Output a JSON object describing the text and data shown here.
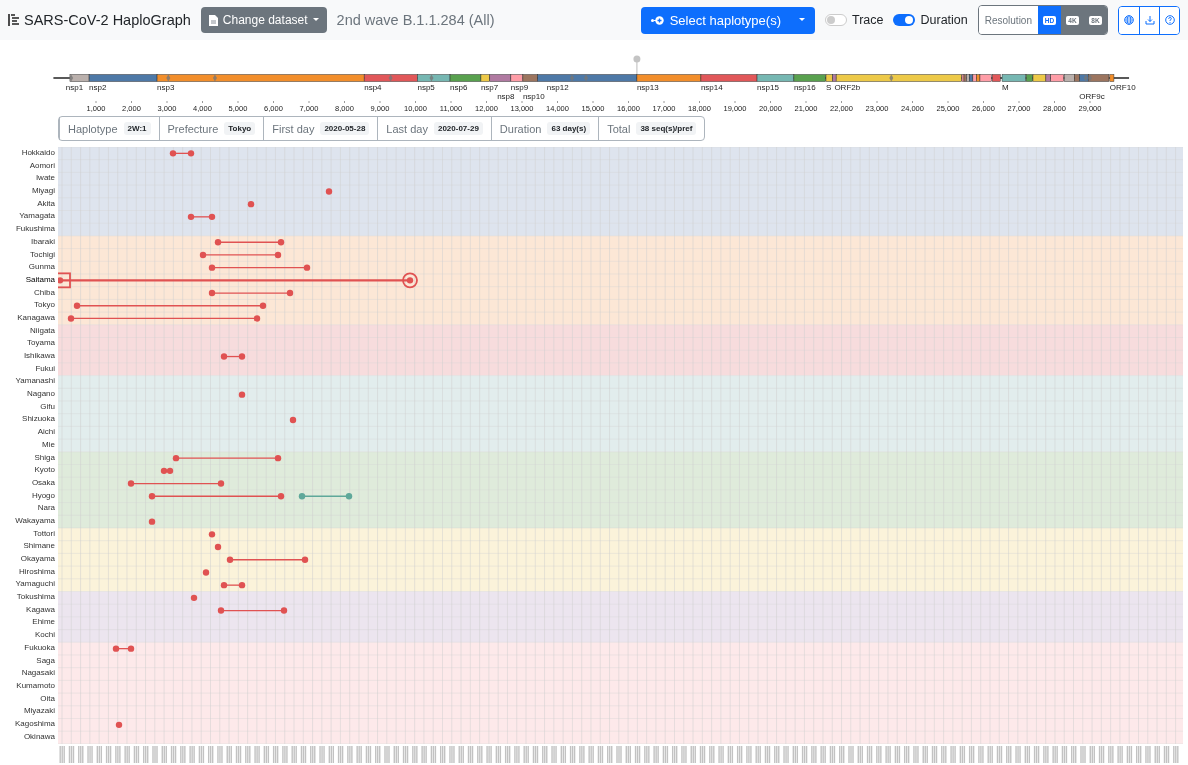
{
  "header": {
    "title": "SARS-CoV-2 HaploGraph",
    "dataset_button": "Change dataset",
    "dataset_name": "2nd wave B.1.1.284 (All)",
    "haplotype_button": "Select haplotype(s)",
    "toggles": [
      {
        "label": "Trace",
        "on": false
      },
      {
        "label": "Duration",
        "on": true
      }
    ],
    "resolution": {
      "label": "Resolution",
      "options": [
        {
          "label": "HD",
          "selected": true
        },
        {
          "label": "4K",
          "selected": false
        },
        {
          "label": "8K",
          "selected": false
        }
      ]
    }
  },
  "genome": {
    "labels": [
      "nsp1",
      "nsp2",
      "nsp3",
      "nsp4",
      "nsp5",
      "nsp6",
      "nsp7",
      "nsp8",
      "nsp9",
      "nsp10",
      "nsp12",
      "nsp13",
      "nsp14",
      "nsp15",
      "nsp16",
      "S",
      "ORF2b",
      "M",
      "ORF9c",
      "ORF10"
    ],
    "ticks": [
      "1,000",
      "2,000",
      "3,000",
      "4,000",
      "5,000",
      "6,000",
      "7,000",
      "8,000",
      "9,000",
      "10,000",
      "11,000",
      "12,000",
      "13,000",
      "14,000",
      "15,000",
      "16,000",
      "17,000",
      "18,000",
      "19,000",
      "20,000",
      "21,000",
      "22,000",
      "23,000",
      "24,000",
      "25,000",
      "26,000",
      "27,000",
      "28,000",
      "29,000"
    ]
  },
  "info": [
    {
      "label": "Haplotype",
      "value": "2W:1"
    },
    {
      "label": "Prefecture",
      "value": "Tokyo"
    },
    {
      "label": "First day",
      "value": "2020-05-28"
    },
    {
      "label": "Last day",
      "value": "2020-07-29"
    },
    {
      "label": "Duration",
      "value": "63 day(s)"
    },
    {
      "label": "Total",
      "value": "38 seq(s)/pref"
    }
  ],
  "regions": [
    {
      "color": "#dee4ee",
      "prefectures": [
        {
          "name": "Hokkaido",
          "selected": false
        },
        {
          "name": "Aomori",
          "selected": false
        },
        {
          "name": "Iwate",
          "selected": false
        },
        {
          "name": "Miyagi",
          "selected": false
        },
        {
          "name": "Akita",
          "selected": false
        },
        {
          "name": "Yamagata",
          "selected": false
        },
        {
          "name": "Fukushima",
          "selected": false
        }
      ]
    },
    {
      "color": "#fce7d6",
      "prefectures": [
        {
          "name": "Ibaraki",
          "selected": false
        },
        {
          "name": "Tochigi",
          "selected": false
        },
        {
          "name": "Gunma",
          "selected": false
        },
        {
          "name": "Saitama",
          "selected": true
        },
        {
          "name": "Chiba",
          "selected": false
        },
        {
          "name": "Tokyo",
          "selected": false
        },
        {
          "name": "Kanagawa",
          "selected": false
        }
      ]
    },
    {
      "color": "#f7dcdd",
      "prefectures": [
        {
          "name": "Niigata",
          "selected": false
        },
        {
          "name": "Toyama",
          "selected": false
        },
        {
          "name": "Ishikawa",
          "selected": false
        },
        {
          "name": "Fukui",
          "selected": false
        }
      ]
    },
    {
      "color": "#e2eded",
      "prefectures": [
        {
          "name": "Yamanashi",
          "selected": false
        },
        {
          "name": "Nagano",
          "selected": false
        },
        {
          "name": "Gifu",
          "selected": false
        },
        {
          "name": "Shizuoka",
          "selected": false
        },
        {
          "name": "Aichi",
          "selected": false
        },
        {
          "name": "Mie",
          "selected": false
        }
      ]
    },
    {
      "color": "#dfebdb",
      "prefectures": [
        {
          "name": "Shiga",
          "selected": false
        },
        {
          "name": "Kyoto",
          "selected": false
        },
        {
          "name": "Osaka",
          "selected": false
        },
        {
          "name": "Hyogo",
          "selected": false
        },
        {
          "name": "Nara",
          "selected": false
        },
        {
          "name": "Wakayama",
          "selected": false
        }
      ]
    },
    {
      "color": "#fbf3da",
      "prefectures": [
        {
          "name": "Tottori",
          "selected": false
        },
        {
          "name": "Shimane",
          "selected": false
        },
        {
          "name": "Okayama",
          "selected": false
        },
        {
          "name": "Hiroshima",
          "selected": false
        },
        {
          "name": "Yamaguchi",
          "selected": false
        }
      ]
    },
    {
      "color": "#ece5ef",
      "prefectures": [
        {
          "name": "Tokushima",
          "selected": false
        },
        {
          "name": "Kagawa",
          "selected": false
        },
        {
          "name": "Ehime",
          "selected": false
        },
        {
          "name": "Kochi",
          "selected": false
        }
      ]
    },
    {
      "color": "#fde9ea",
      "prefectures": [
        {
          "name": "Fukuoka",
          "selected": false
        },
        {
          "name": "Saga",
          "selected": false
        },
        {
          "name": "Nagasaki",
          "selected": false
        },
        {
          "name": "Kumamoto",
          "selected": false
        },
        {
          "name": "Oita",
          "selected": false
        },
        {
          "name": "Miyazaki",
          "selected": false
        },
        {
          "name": "Kagoshima",
          "selected": false
        },
        {
          "name": "Okinawa",
          "selected": false
        }
      ]
    }
  ]
}
